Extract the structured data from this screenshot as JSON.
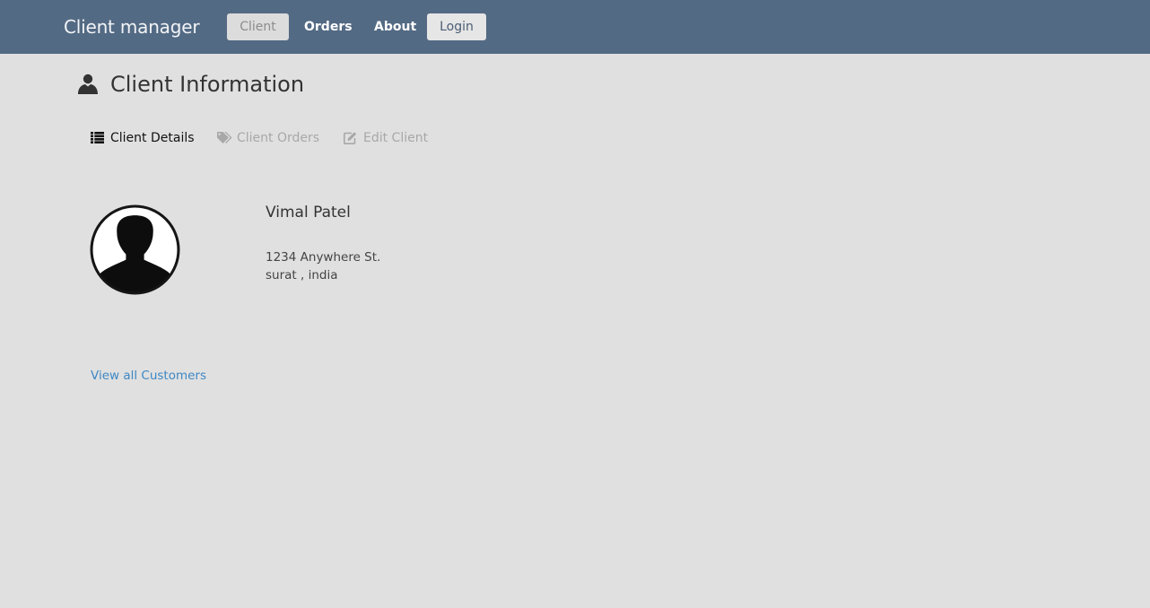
{
  "navbar": {
    "brand": "Client manager",
    "items": [
      {
        "label": "Client",
        "state": "disabled"
      },
      {
        "label": "Orders"
      },
      {
        "label": "About"
      },
      {
        "label": "Login"
      }
    ]
  },
  "page": {
    "title": "Client Information",
    "title_icon": "user-icon"
  },
  "tabs": [
    {
      "label": "Client Details",
      "icon": "list-icon",
      "active": true
    },
    {
      "label": "Client Orders",
      "icon": "tags-icon",
      "active": false
    },
    {
      "label": "Edit Client",
      "icon": "edit-icon",
      "active": false
    }
  ],
  "client": {
    "avatar_icon": "avatar-icon",
    "name": "Vimal Patel",
    "address_line1": "1234 Anywhere St.",
    "address_line2": "surat , india"
  },
  "links": {
    "view_all": "View all Customers"
  },
  "colors": {
    "navbar": "#536a84",
    "background": "#e0e0e0",
    "link": "#3e87c4",
    "muted": "#a8a8a8"
  }
}
